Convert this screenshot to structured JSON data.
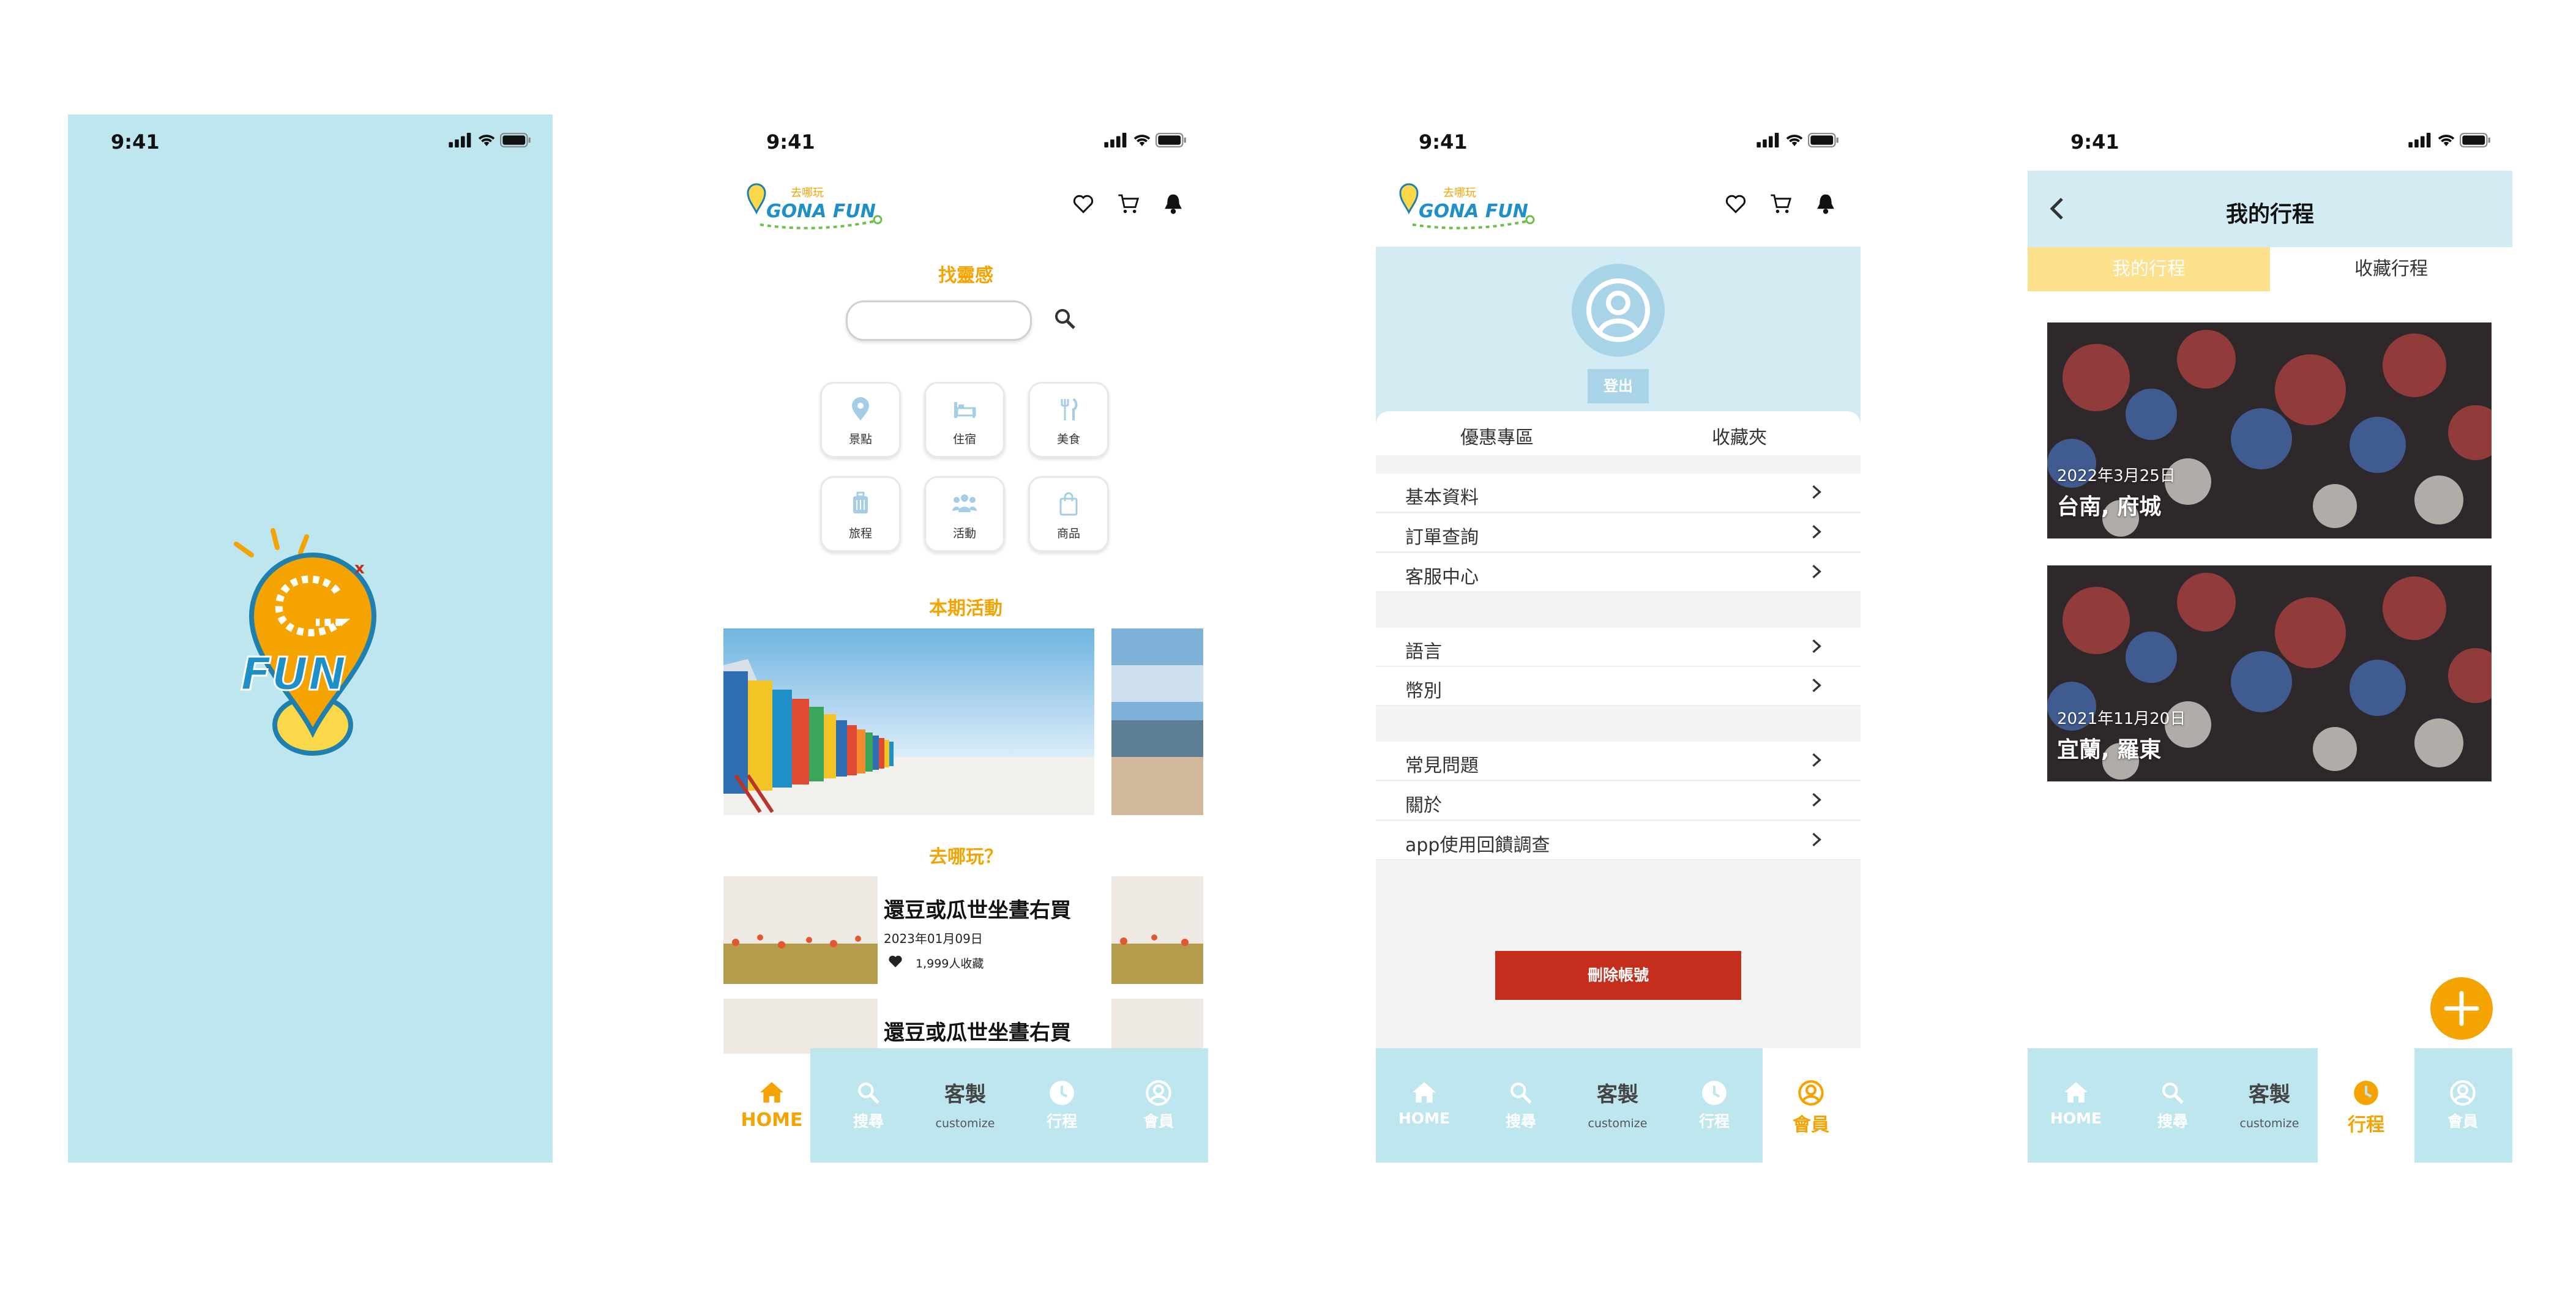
{
  "status_time": "9:41",
  "app": {
    "logo_text": "GONA FUN",
    "logo_sub": "去哪玩"
  },
  "splash": {
    "logo_text": "FUN",
    "logo_sub": "GONA"
  },
  "home": {
    "search_title": "找靈感",
    "search_placeholder": "",
    "categories": [
      {
        "label": "景點",
        "icon": "location-pin-icon"
      },
      {
        "label": "住宿",
        "icon": "bed-icon"
      },
      {
        "label": "美食",
        "icon": "fork-knife-icon"
      },
      {
        "label": "旅程",
        "icon": "suitcase-icon"
      },
      {
        "label": "活動",
        "icon": "people-icon"
      },
      {
        "label": "商品",
        "icon": "shopping-bag-icon"
      }
    ],
    "activities_title": "本期活動",
    "where_title": "去哪玩？",
    "posts": [
      {
        "title": "還豆或瓜世坐晝右買",
        "date": "2023年01月09日",
        "likes": "1,999人收藏"
      },
      {
        "title": "還豆或瓜世坐晝右買"
      }
    ]
  },
  "member": {
    "logout": "登出",
    "tabs": [
      "優惠專區",
      "收藏夾"
    ],
    "group1": [
      "基本資料",
      "訂單查詢",
      "客服中心"
    ],
    "group2": [
      "語言",
      "幣別"
    ],
    "group3": [
      "常見問題",
      "關於",
      "app使用回饋調查"
    ],
    "delete_account": "刪除帳號"
  },
  "trips": {
    "title": "我的行程",
    "tabs": [
      "我的行程",
      "收藏行程"
    ],
    "cards": [
      {
        "date": "2022年3月25日",
        "place": "台南, 府城"
      },
      {
        "date": "2021年11月20日",
        "place": "宜蘭, 羅東"
      }
    ]
  },
  "nav": {
    "home": "HOME",
    "search": "搜尋",
    "custom_big": "客製",
    "custom_small": "customize",
    "trips": "行程",
    "member": "會員"
  },
  "colors": {
    "sky": "#bde6ef",
    "orange": "#f5a300",
    "danger": "#c52d1c",
    "tab_active": "#fde08b"
  }
}
